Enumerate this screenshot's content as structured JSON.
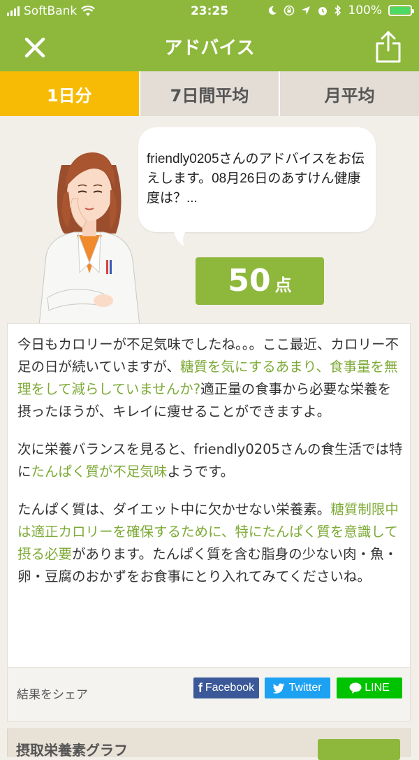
{
  "status": {
    "carrier": "SoftBank",
    "time": "23:25",
    "battery": "100%",
    "icons": [
      "signal-icon",
      "wifi-icon",
      "moon-icon",
      "rotation-lock-icon",
      "location-icon",
      "alarm-icon",
      "bluetooth-icon",
      "battery-icon"
    ]
  },
  "nav": {
    "title": "アドバイス",
    "close_icon": "close-icon",
    "share_icon": "share-icon"
  },
  "tabs": [
    {
      "label": "1日分",
      "active": true
    },
    {
      "label": "7日間平均",
      "active": false
    },
    {
      "label": "月平均",
      "active": false
    }
  ],
  "bubble": {
    "text": "friendly0205さんのアドバイスをお伝えします。08月26日のあすけん健康度は？..."
  },
  "score": {
    "value": "50",
    "unit": "点"
  },
  "advice": {
    "p1_a": "今日もカロリーが不足気味でしたね。。。ここ最近、カロリー不足の日が続いていますが、",
    "p1_hl": "糖質を気にするあまり、食事量を無理をして減らしていませんか?",
    "p1_b": "適正量の食事から必要な栄養を摂ったほうが、キレイに痩せることができますよ。",
    "p2_a": "次に栄養バランスを見ると、friendly0205さんの食生活では特に",
    "p2_hl": "たんぱく質が不足気味",
    "p2_b": "ようです。",
    "p3_a": "たんぱく質は、ダイエット中に欠かせない栄養素。",
    "p3_hl": "糖質制限中は適正カロリーを確保するために、特にたんぱく質を意識して摂る必要",
    "p3_b": "があります。たんぱく質を含む脂身の少ない肉・魚・卵・豆腐のおかずをお食事にとり入れてみてくださいね。"
  },
  "share": {
    "label": "結果をシェア",
    "facebook": "Facebook",
    "twitter": "Twitter",
    "line": "LINE"
  },
  "next_section": {
    "title": "摂取栄養素グラフ"
  },
  "colors": {
    "brand_green": "#8db83c",
    "tab_active": "#f7bb06",
    "highlight": "#7daa36",
    "facebook": "#3b5998",
    "twitter": "#1da1f2",
    "line": "#00c300"
  }
}
